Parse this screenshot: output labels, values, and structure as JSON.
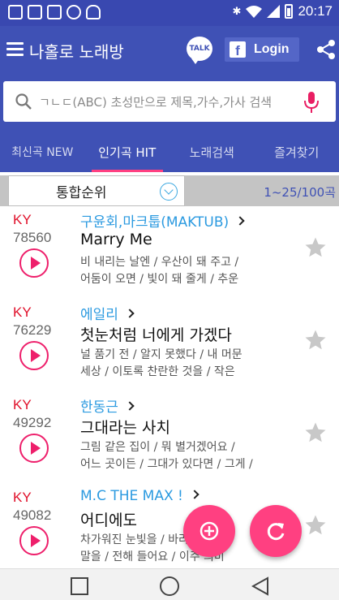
{
  "status_bar": {
    "time": "20:17",
    "icons": [
      "text-icon",
      "image-icon",
      "mail-icon",
      "usb-icon",
      "android-icon",
      "bluetooth-icon",
      "wifi-icon",
      "signal-icon",
      "battery-icon"
    ]
  },
  "app_bar": {
    "title": "나홀로 노래방",
    "talk_label": "TALK",
    "login_label": "Login",
    "fb_letter": "f"
  },
  "search": {
    "placeholder": "ㄱㄴㄷ(ABC) 초성만으로 제목,가수,가사 검색"
  },
  "tabs": [
    {
      "label": "최신곡 NEW",
      "active": false
    },
    {
      "label": "인기곡 HIT",
      "active": true
    },
    {
      "label": "노래검색",
      "active": false
    },
    {
      "label": "즐겨찾기",
      "active": false
    }
  ],
  "filter": {
    "sort_label": "통합순위",
    "page_range": "1~25/100곡"
  },
  "songs": [
    {
      "brand": "KY",
      "number": "78560",
      "artist": "구윤회,마크툽(MAKTUB)",
      "title": "Marry Me",
      "lyric_line1": "비 내리는 날엔 / 우산이 돼 주고 /",
      "lyric_line2": "어둠이 오면 / 빛이 돼 줄게 / 추운"
    },
    {
      "brand": "KY",
      "number": "76229",
      "artist": "에일리",
      "title": "첫눈처럼 너에게 가겠다",
      "lyric_line1": "널 품기 전 / 알지 못했다 / 내 머문",
      "lyric_line2": "세상 / 이토록 찬란한 것을 / 작은"
    },
    {
      "brand": "KY",
      "number": "49292",
      "artist": "한동근",
      "title": "그대라는 사치",
      "lyric_line1": "그림 같은 집이 / 뭐 별거겠어요 /",
      "lyric_line2": "어느 곳이든 / 그대가 있다면 / 그게 /"
    },
    {
      "brand": "KY",
      "number": "49082",
      "artist": "M.C THE MAX !",
      "title": "어디에도",
      "lyric_line1": "차가워진 눈빛을 / 바라보다 / 이",
      "lyric_line2": "말을 / 전해 들어요 / 이주 의미"
    }
  ],
  "colors": {
    "primary": "#3f51b5",
    "status_bar": "#3948b0",
    "accent": "#ff4081",
    "ky_red": "#e0102a",
    "artist_blue": "#2b9ae0"
  }
}
